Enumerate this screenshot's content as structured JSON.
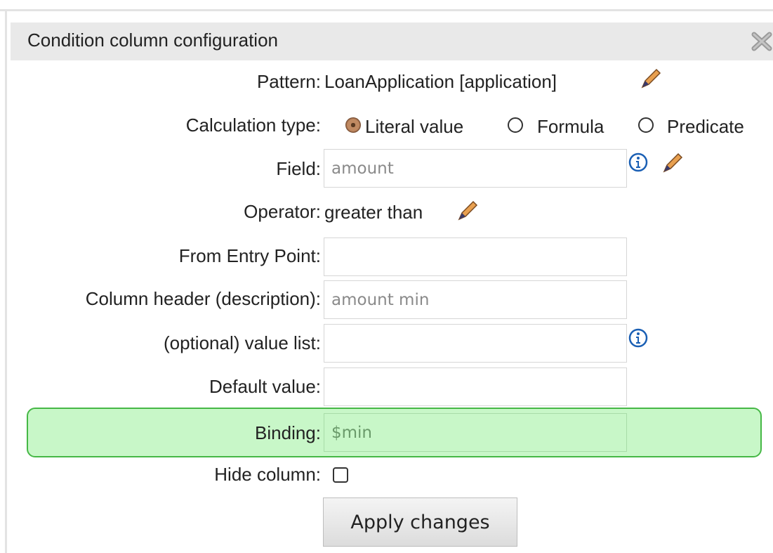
{
  "dialog": {
    "title": "Condition column configuration"
  },
  "pattern": {
    "label": "Pattern:",
    "value": "LoanApplication [application]"
  },
  "calculation_type": {
    "label": "Calculation type:",
    "options": [
      "Literal value",
      "Formula",
      "Predicate"
    ],
    "selected": "Literal value"
  },
  "field": {
    "label": "Field:",
    "value": "amount"
  },
  "operator": {
    "label": "Operator:",
    "value": "greater than"
  },
  "entry_point": {
    "label": "From Entry Point:",
    "value": ""
  },
  "column_header": {
    "label": "Column header (description):",
    "value": "amount min"
  },
  "value_list": {
    "label": "(optional) value list:",
    "value": ""
  },
  "default_value": {
    "label": "Default value:",
    "value": ""
  },
  "binding": {
    "label": "Binding:",
    "value": "$min"
  },
  "hide_column": {
    "label": "Hide column:",
    "checked": false
  },
  "apply_label": "Apply changes",
  "colors": {
    "binding_bg": "#c8f7c8",
    "binding_border": "#46b846",
    "info_icon": "#1a5fb4"
  }
}
